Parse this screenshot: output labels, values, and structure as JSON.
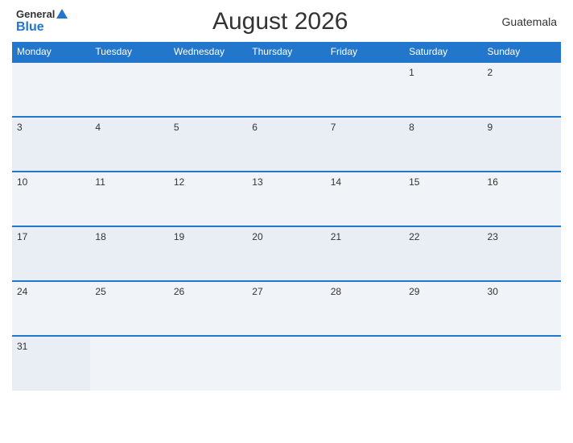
{
  "header": {
    "logo_general": "General",
    "logo_blue": "Blue",
    "month_title": "August 2026",
    "country": "Guatemala"
  },
  "weekdays": [
    "Monday",
    "Tuesday",
    "Wednesday",
    "Thursday",
    "Friday",
    "Saturday",
    "Sunday"
  ],
  "weeks": [
    [
      null,
      null,
      null,
      null,
      null,
      1,
      2
    ],
    [
      3,
      4,
      5,
      6,
      7,
      8,
      9
    ],
    [
      10,
      11,
      12,
      13,
      14,
      15,
      16
    ],
    [
      17,
      18,
      19,
      20,
      21,
      22,
      23
    ],
    [
      24,
      25,
      26,
      27,
      28,
      29,
      30
    ],
    [
      31,
      null,
      null,
      null,
      null,
      null,
      null
    ]
  ]
}
